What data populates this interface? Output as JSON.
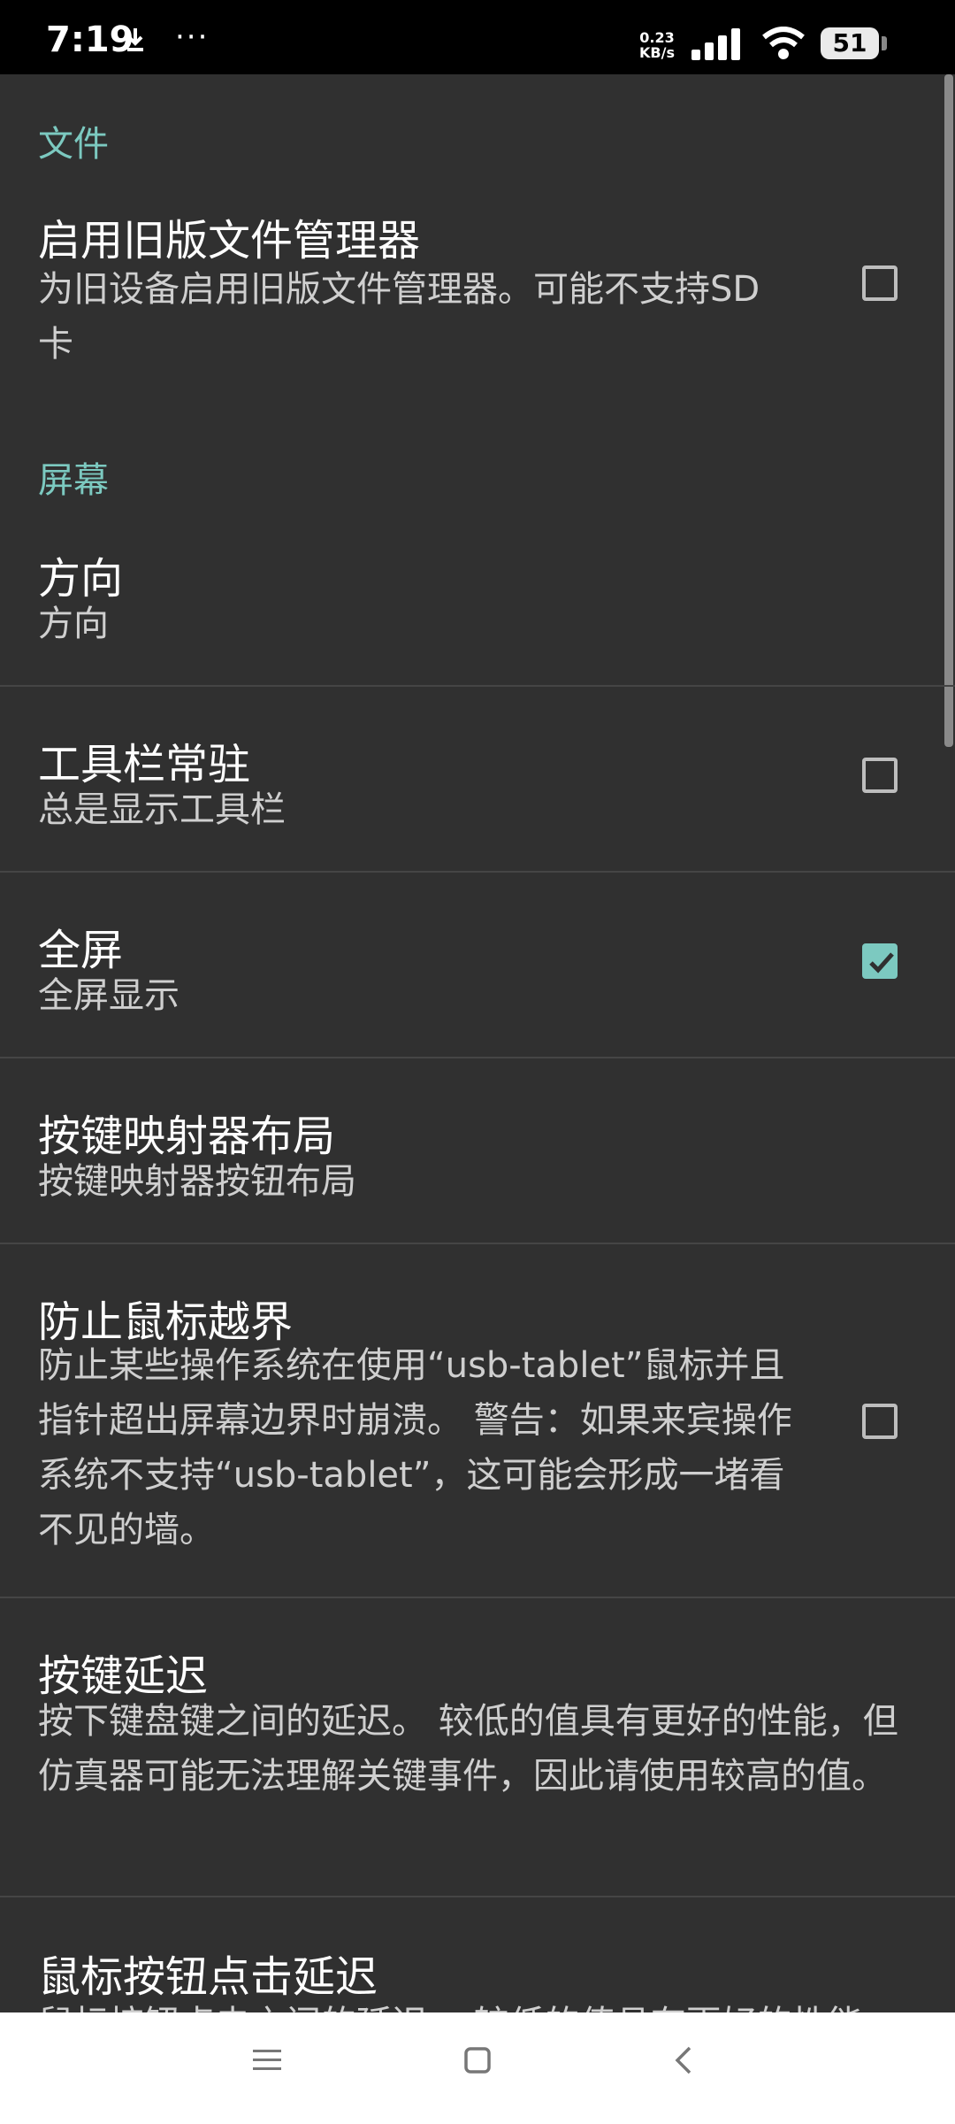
{
  "status_bar": {
    "time": "7:19",
    "dots": "···",
    "net_speed_value": "0.23",
    "net_speed_unit": "KB/s",
    "battery": "51"
  },
  "sections": {
    "file_header": "文件",
    "screen_header": "屏幕"
  },
  "settings": [
    {
      "title": "启用旧版文件管理器",
      "summary": "为旧设备启用旧版文件管理器。可能不支持SD卡",
      "checked": false
    },
    {
      "title": "方向",
      "summary": "方向"
    },
    {
      "title": "工具栏常驻",
      "summary": "总是显示工具栏",
      "checked": false
    },
    {
      "title": "全屏",
      "summary": "全屏显示",
      "checked": true
    },
    {
      "title": "按键映射器布局",
      "summary": "按键映射器按钮布局"
    },
    {
      "title": "防止鼠标越界",
      "summary": "防止某些操作系统在使用“usb-tablet”鼠标并且指针超出屏幕边界时崩溃。 警告：如果来宾操作系统不支持“usb-tablet”，这可能会形成一堵看不见的墙。",
      "checked": false
    },
    {
      "title": "按键延迟",
      "summary": "按下键盘键之间的延迟。 较低的值具有更好的性能，但仿真器可能无法理解关键事件，因此请使用较高的值。"
    },
    {
      "title": "鼠标按钮点击延迟",
      "summary": "鼠标按钮点击之间的延迟。 较低的值具有更好的性能"
    }
  ],
  "colors": {
    "accent": "#7cc9c0",
    "background": "#303030",
    "divider": "#454545"
  },
  "nav": {
    "menu_icon": "menu-icon",
    "home_icon": "home-icon",
    "back_icon": "back-icon"
  }
}
